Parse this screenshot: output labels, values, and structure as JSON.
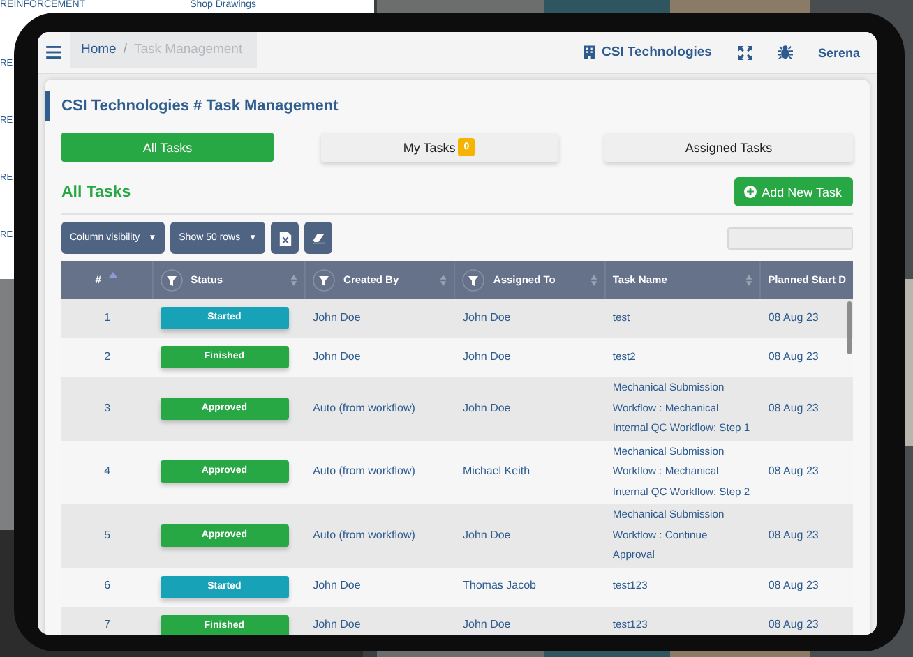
{
  "background_page": {
    "top_items": [
      "REINFORCEMENT",
      "Shop Drawings"
    ],
    "side_items": [
      "RE",
      "RE",
      "RE",
      "RE"
    ]
  },
  "topbar": {
    "breadcrumb": [
      {
        "label": "Home",
        "current": false
      },
      {
        "label": "Task Management",
        "current": true
      }
    ],
    "separator": "/",
    "company": "CSI Technologies",
    "user": "Serena"
  },
  "page_title": "CSI Technologies # Task Management",
  "tabs": [
    {
      "label": "All Tasks",
      "selected": true
    },
    {
      "label": "My Tasks",
      "selected": false,
      "badge": "0"
    },
    {
      "label": "Assigned Tasks",
      "selected": false
    }
  ],
  "section_title": "All Tasks",
  "add_button": "Add New Task",
  "toolbar": {
    "column_visibility": "Column visibility",
    "rows_menu": "Show 50 rows",
    "caret": "▼"
  },
  "table": {
    "columns": [
      {
        "label": "#",
        "filter": false
      },
      {
        "label": "Status",
        "filter": true
      },
      {
        "label": "Created By",
        "filter": true
      },
      {
        "label": "Assigned To",
        "filter": true
      },
      {
        "label": "Task Name",
        "filter": false
      },
      {
        "label": "Planned Start D",
        "filter": false
      }
    ],
    "rows": [
      {
        "number": "1",
        "status": {
          "label": "Started",
          "color": "#17a2b8"
        },
        "created_by": "John Doe",
        "assigned_to": "John Doe",
        "task_name": "test",
        "planned_start": "08 Aug 23"
      },
      {
        "number": "2",
        "status": {
          "label": "Finished",
          "color": "#28a745"
        },
        "created_by": "John Doe",
        "assigned_to": "John Doe",
        "task_name": "test2",
        "planned_start": "08 Aug 23"
      },
      {
        "number": "3",
        "status": {
          "label": "Approved",
          "color": "#28a745"
        },
        "created_by": "Auto (from workflow)",
        "assigned_to": "John Doe",
        "task_name": "Mechanical Submission\nWorkflow : Mechanical\nInternal QC Workflow: Step 1",
        "planned_start": "08 Aug 23"
      },
      {
        "number": "4",
        "status": {
          "label": "Approved",
          "color": "#28a745"
        },
        "created_by": "Auto (from workflow)",
        "assigned_to": "Michael Keith",
        "task_name": "Mechanical Submission\nWorkflow : Mechanical\nInternal QC Workflow: Step 2",
        "planned_start": "08 Aug 23"
      },
      {
        "number": "5",
        "status": {
          "label": "Approved",
          "color": "#28a745"
        },
        "created_by": "Auto (from workflow)",
        "assigned_to": "John Doe",
        "task_name": "Mechanical Submission\nWorkflow : Continue\nApproval",
        "planned_start": "08 Aug 23"
      },
      {
        "number": "6",
        "status": {
          "label": "Started",
          "color": "#17a2b8"
        },
        "created_by": "John Doe",
        "assigned_to": "Thomas Jacob",
        "task_name": "test123",
        "planned_start": "08 Aug 23"
      },
      {
        "number": "7",
        "status": {
          "label": "Finished",
          "color": "#28a745"
        },
        "created_by": "John Doe",
        "assigned_to": "John Doe",
        "task_name": "test123",
        "planned_start": "08 Aug 23"
      }
    ]
  }
}
